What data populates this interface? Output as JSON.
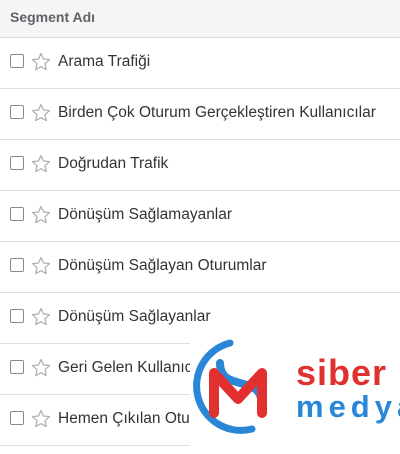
{
  "header": {
    "column_label": "Segment Adı"
  },
  "segments": [
    {
      "label": "Arama Trafiği",
      "checked": false,
      "starred": false
    },
    {
      "label": "Birden Çok Oturum Gerçekleştiren Kullanıcılar",
      "checked": false,
      "starred": false
    },
    {
      "label": "Doğrudan Trafik",
      "checked": false,
      "starred": false
    },
    {
      "label": "Dönüşüm Sağlamayanlar",
      "checked": false,
      "starred": false
    },
    {
      "label": "Dönüşüm Sağlayan Oturumlar",
      "checked": false,
      "starred": false
    },
    {
      "label": "Dönüşüm Sağlayanlar",
      "checked": false,
      "starred": false
    },
    {
      "label": "Geri Gelen Kullanıcılar",
      "checked": false,
      "starred": false
    },
    {
      "label": "Hemen Çıkılan Oturumlar",
      "checked": false,
      "starred": false
    }
  ],
  "watermark": {
    "line1": "siber",
    "line2": "medya"
  },
  "colors": {
    "watermark_red": "#e0312f",
    "watermark_blue": "#2a86d6"
  },
  "icons": {
    "checkbox": "checkbox-icon",
    "star": "star-outline-icon"
  }
}
